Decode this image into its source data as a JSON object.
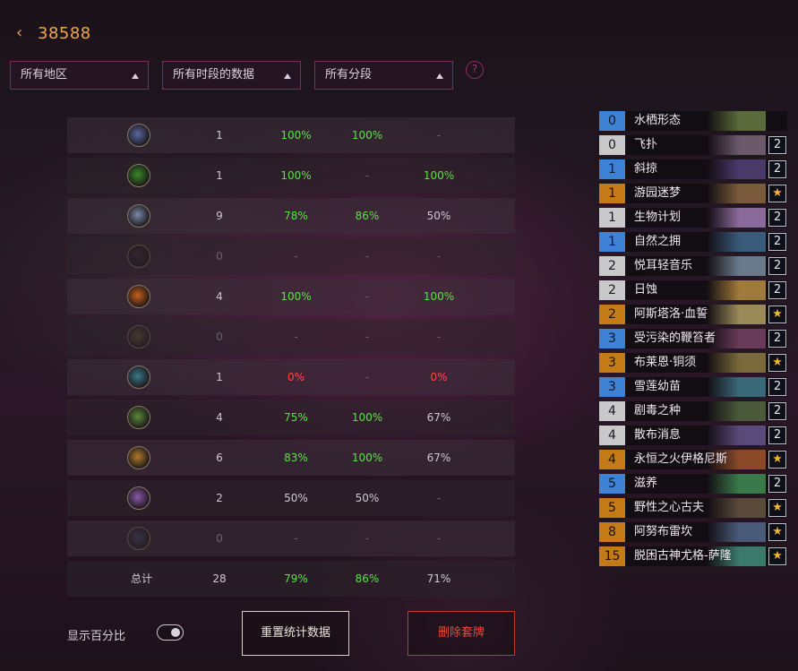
{
  "header": {
    "title": "38588"
  },
  "filters": {
    "region": "所有地区",
    "time": "所有时段的数据",
    "rank": "所有分段"
  },
  "help": "?",
  "stats_rows": [
    {
      "icon": "mage-class-icon",
      "color": "#5a6aa0",
      "games": "1",
      "p1": "100%",
      "p2": "100%",
      "p3": "-"
    },
    {
      "icon": "demon-hunter-class-icon",
      "color": "#3a8a2a",
      "games": "1",
      "p1": "100%",
      "p2": "-",
      "p3": "100%"
    },
    {
      "icon": "druid-class-icon",
      "color": "#7a8aa8",
      "games": "9",
      "p1": "78%",
      "p2": "86%",
      "p3": "50%"
    },
    {
      "icon": "rogue-class-icon",
      "color": "#3a2a2a",
      "games": "0",
      "p1": "-",
      "p2": "-",
      "p3": "-"
    },
    {
      "icon": "warrior-class-icon",
      "color": "#c8601a",
      "games": "4",
      "p1": "100%",
      "p2": "-",
      "p3": "100%"
    },
    {
      "icon": "shaman-class-icon",
      "color": "#6a5a3a",
      "games": "0",
      "p1": "-",
      "p2": "-",
      "p3": "-"
    },
    {
      "icon": "priest-class-icon",
      "color": "#3a7a8a",
      "games": "1",
      "p1": "0%",
      "p2": "-",
      "p3": "0%"
    },
    {
      "icon": "hunter-class-icon",
      "color": "#5a8a3a",
      "games": "4",
      "p1": "75%",
      "p2": "100%",
      "p3": "67%"
    },
    {
      "icon": "paladin-class-icon",
      "color": "#b07a2a",
      "games": "6",
      "p1": "83%",
      "p2": "100%",
      "p3": "67%"
    },
    {
      "icon": "warlock-class-icon",
      "color": "#8a5aa8",
      "games": "2",
      "p1": "50%",
      "p2": "50%",
      "p3": "-"
    },
    {
      "icon": "death-knight-class-icon",
      "color": "#3a4a5a",
      "games": "0",
      "p1": "-",
      "p2": "-",
      "p3": "-"
    }
  ],
  "total_row": {
    "label": "总计",
    "games": "28",
    "p1": "79%",
    "p2": "86%",
    "p3": "71%"
  },
  "cards": [
    {
      "cost": "0",
      "name": "水栖形态",
      "rarity": "blue",
      "count": "",
      "art": "#5a6a3a"
    },
    {
      "cost": "0",
      "name": "飞扑",
      "rarity": "gray",
      "count": "2",
      "art": "#6a5a6a"
    },
    {
      "cost": "1",
      "name": "斜掠",
      "rarity": "blue",
      "count": "2",
      "art": "#4a3a6a"
    },
    {
      "cost": "1",
      "name": "游园迷梦",
      "rarity": "orange",
      "count": "★",
      "art": "#7a5a3a"
    },
    {
      "cost": "1",
      "name": "生物计划",
      "rarity": "gray",
      "count": "2",
      "art": "#8a6a9a"
    },
    {
      "cost": "1",
      "name": "自然之拥",
      "rarity": "blue",
      "count": "2",
      "art": "#3a5a7a"
    },
    {
      "cost": "2",
      "name": "悦耳轻音乐",
      "rarity": "gray",
      "count": "2",
      "art": "#6a7a8a"
    },
    {
      "cost": "2",
      "name": "日蚀",
      "rarity": "gray",
      "count": "2",
      "art": "#a07a3a"
    },
    {
      "cost": "2",
      "name": "阿斯塔洛·血誓",
      "rarity": "orange",
      "count": "★",
      "art": "#9a8a5a"
    },
    {
      "cost": "3",
      "name": "受污染的鞭笞者",
      "rarity": "blue",
      "count": "2",
      "art": "#6a3a5a"
    },
    {
      "cost": "3",
      "name": "布莱恩·铜须",
      "rarity": "orange",
      "count": "★",
      "art": "#7a6a3a"
    },
    {
      "cost": "3",
      "name": "雪莲幼苗",
      "rarity": "blue",
      "count": "2",
      "art": "#3a6a7a"
    },
    {
      "cost": "4",
      "name": "剧毒之种",
      "rarity": "gray",
      "count": "2",
      "art": "#4a5a3a"
    },
    {
      "cost": "4",
      "name": "散布消息",
      "rarity": "gray",
      "count": "2",
      "art": "#5a4a7a"
    },
    {
      "cost": "4",
      "name": "永恒之火伊格尼斯",
      "rarity": "orange",
      "count": "★",
      "art": "#8a4a2a"
    },
    {
      "cost": "5",
      "name": "滋养",
      "rarity": "blue",
      "count": "2",
      "art": "#3a7a4a"
    },
    {
      "cost": "5",
      "name": "野性之心古夫",
      "rarity": "orange",
      "count": "★",
      "art": "#5a4a3a"
    },
    {
      "cost": "8",
      "name": "阿努布雷坎",
      "rarity": "orange",
      "count": "★",
      "art": "#4a5a7a"
    },
    {
      "cost": "15",
      "name": "脱困古神尤格-萨隆",
      "rarity": "orange",
      "count": "★",
      "art": "#3a7a6a"
    }
  ],
  "footer": {
    "show_percent_label": "显示百分比",
    "reset_label": "重置统计数据",
    "delete_label": "删除套牌"
  }
}
